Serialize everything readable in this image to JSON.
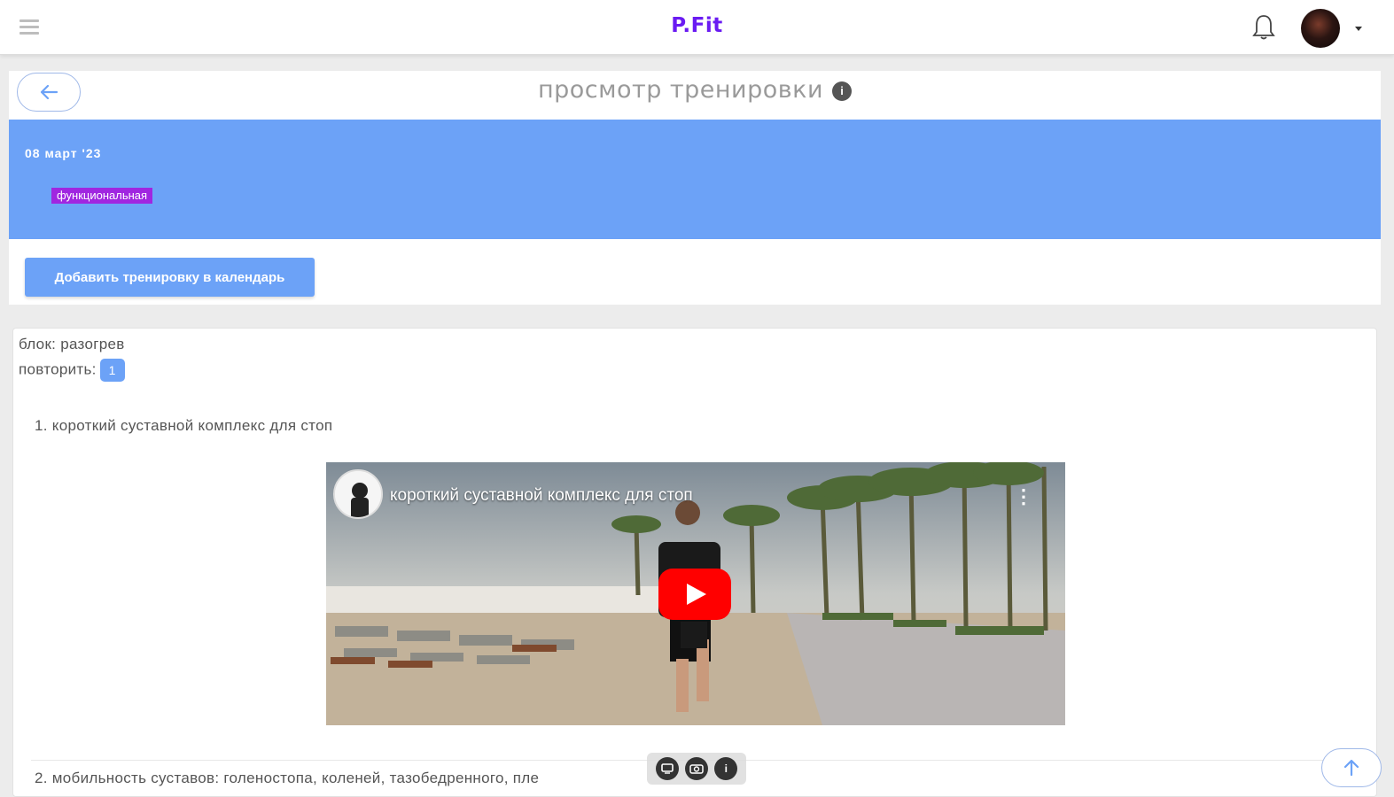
{
  "header": {
    "brand": "P.Fit"
  },
  "page": {
    "title": "просмотр тренировки",
    "info_glyph": "i"
  },
  "banner": {
    "date": "08 март '23",
    "tag": "функциональная",
    "color": "#6ca2f7",
    "tag_color": "#a026e0"
  },
  "actions": {
    "add_to_calendar": "Добавить тренировку в календарь"
  },
  "block": {
    "label": "блок: разогрев",
    "repeat_label": "повторить:",
    "repeat_count": "1",
    "exercises": [
      {
        "number_title": "1. короткий суставной комплекс для стоп"
      },
      {
        "number_title": "2. мобильность суставов: голеностопа, коленей, тазобедренного, пле"
      }
    ],
    "video": {
      "title": "короткий суставной комплекс для стоп",
      "more_glyph": "⋮"
    }
  },
  "floating_toolbar": {
    "icons": [
      "screen-icon",
      "camera-icon",
      "info-icon"
    ],
    "info_glyph": "i"
  },
  "colors": {
    "brand": "#6a1bf2",
    "accent": "#6ca2f7"
  }
}
